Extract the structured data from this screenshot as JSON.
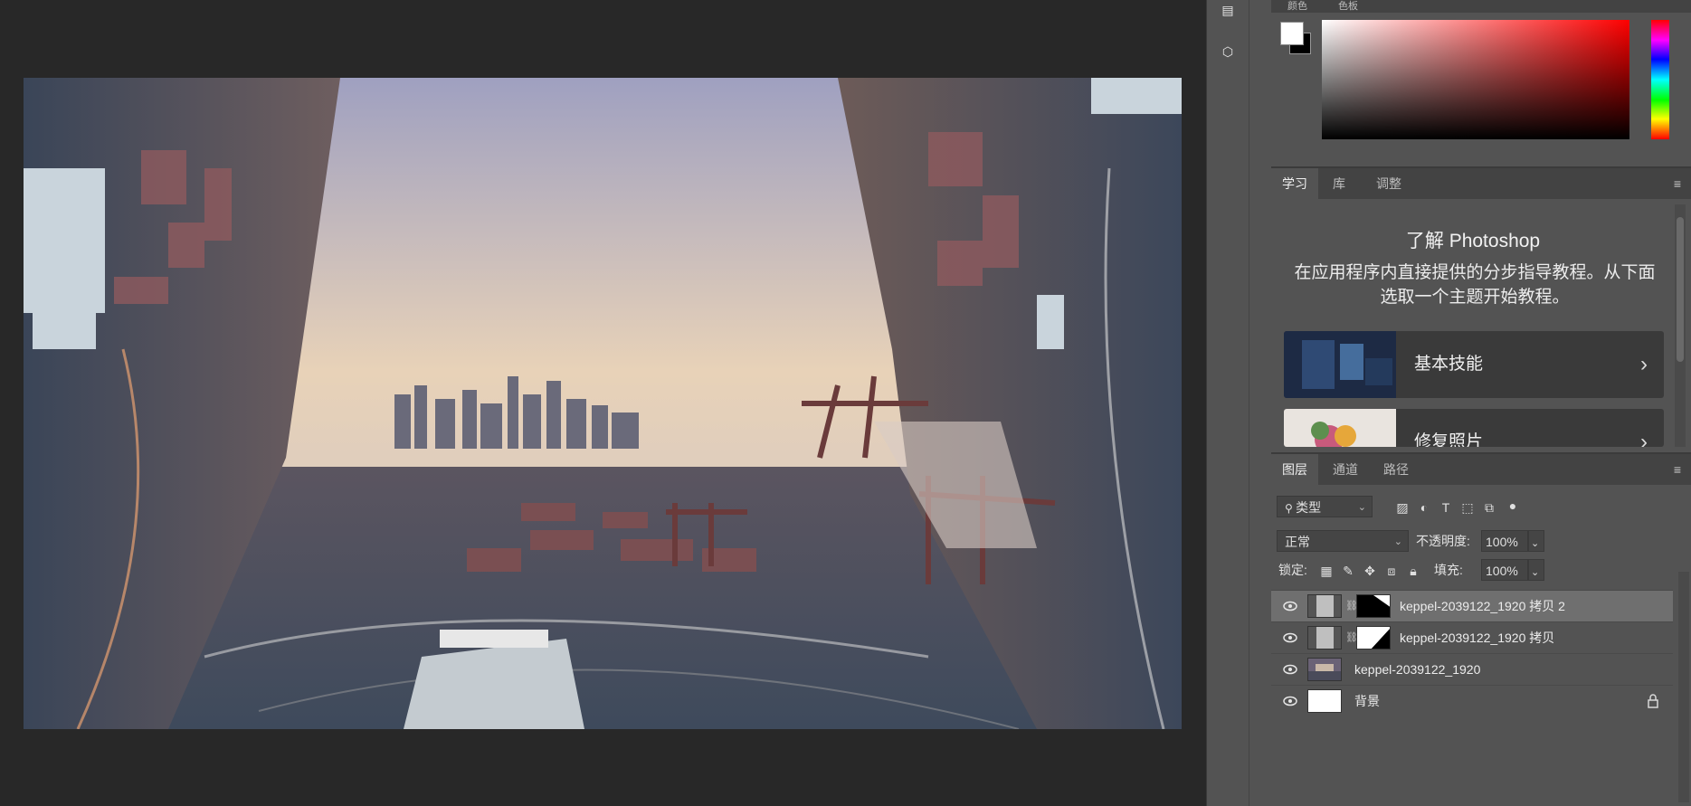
{
  "color_panel": {
    "tabs": [
      "颜色",
      "色板"
    ],
    "foreground_color": "#ffffff",
    "background_color": "#000000"
  },
  "learn_panel": {
    "tabs": [
      "学习",
      "库",
      "调整"
    ],
    "active_tab": "学习",
    "title": "了解 Photoshop",
    "description": "在应用程序内直接提供的分步指导教程。从下面选取一个主题开始教程。",
    "cards": [
      {
        "label": "基本技能",
        "icon": "chevron-right-icon"
      },
      {
        "label": "修复照片",
        "icon": "chevron-right-icon"
      }
    ]
  },
  "layers_panel": {
    "tabs": [
      "图层",
      "通道",
      "路径"
    ],
    "active_tab": "图层",
    "filter_label": "类型",
    "blend_mode": "正常",
    "opacity_label": "不透明度:",
    "opacity_value": "100%",
    "lock_label": "锁定:",
    "fill_label": "填充:",
    "fill_value": "100%",
    "layers": [
      {
        "name": "keppel-2039122_1920 拷贝 2",
        "visible": true,
        "has_mask": true,
        "selected": true
      },
      {
        "name": "keppel-2039122_1920 拷贝",
        "visible": true,
        "has_mask": true,
        "selected": false
      },
      {
        "name": "keppel-2039122_1920",
        "visible": true,
        "has_mask": false,
        "selected": false
      },
      {
        "name": "背景",
        "visible": true,
        "has_mask": false,
        "locked": true,
        "selected": false
      }
    ]
  },
  "colors": {
    "workspace": "#282828",
    "panel": "#535353",
    "selected_layer": "#6f6f6f"
  }
}
